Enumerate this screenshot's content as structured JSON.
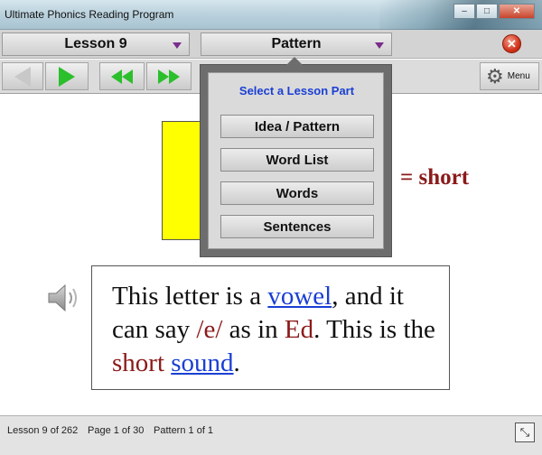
{
  "window": {
    "title": "Ultimate Phonics Reading Program",
    "minimize_glyph": "–",
    "maximize_glyph": "□",
    "close_glyph": "✕"
  },
  "header": {
    "lesson_label": "Lesson 9",
    "pattern_label": "Pattern",
    "close_glyph": "✕"
  },
  "toolbar": {
    "menu_label": "Menu",
    "menu_icon": "gear-icon"
  },
  "dropdown": {
    "title": "Select a Lesson Part",
    "items": [
      "Idea / Pattern",
      "Word List",
      "Words",
      "Sentences"
    ]
  },
  "content": {
    "equals_text": "= short",
    "text_parts": {
      "p1": "This letter is a ",
      "vowel": "vowel",
      "p2": ", and it can say ",
      "sound_e": "/e/",
      "p3": " as in ",
      "ed": "Ed",
      "p4": ". This is the ",
      "short": "short",
      "p5": " ",
      "sound": "sound",
      "p6": "."
    }
  },
  "status": {
    "lesson": "Lesson 9 of 262",
    "page": "Page 1 of 30",
    "pattern": "Pattern 1 of 1",
    "expand_glyph": "⤡"
  },
  "colors": {
    "accent_red": "#8b1a1a",
    "link_blue": "#1a3fd4",
    "play_green": "#2bbf2b",
    "highlight_yellow": "#ffff00"
  }
}
